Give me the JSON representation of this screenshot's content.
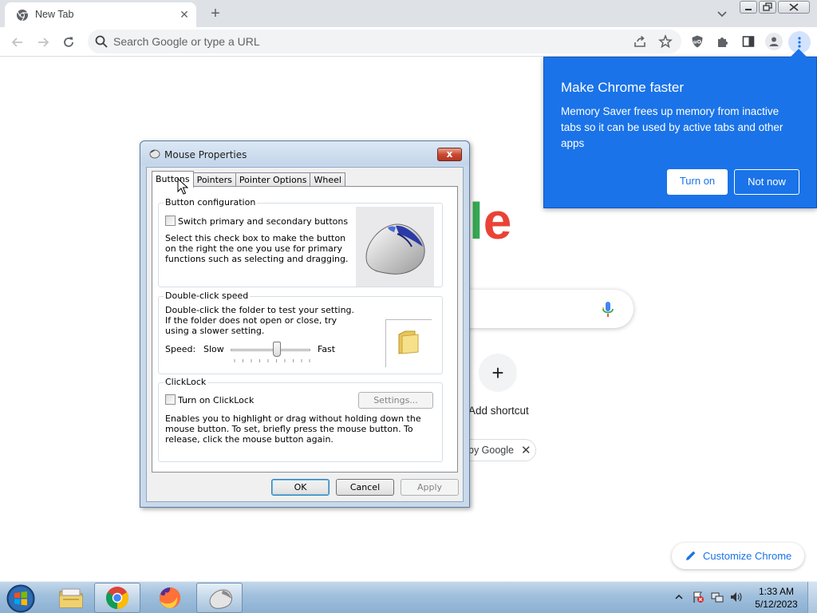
{
  "browser": {
    "tab_title": "New Tab",
    "omnibox_placeholder": "Search Google or type a URL"
  },
  "newtab_page": {
    "logo_fragment": [
      "l",
      "e"
    ],
    "shortcut_plus": "+",
    "shortcut_label": "Add shortcut",
    "chip_text": "by Google",
    "chip_close": "✕",
    "customize_label": "Customize Chrome"
  },
  "bubble": {
    "title": "Make Chrome faster",
    "body": "Memory Saver frees up memory from inactive tabs so it can be used by active tabs and other apps",
    "turn_on": "Turn on",
    "not_now": "Not now"
  },
  "dialog": {
    "title": "Mouse Properties",
    "close_glyph": "x",
    "tabs": [
      "Buttons",
      "Pointers",
      "Pointer Options",
      "Wheel"
    ],
    "button_config": {
      "label": "Button configuration",
      "checkbox": "Switch primary and secondary buttons",
      "desc": "Select this check box to make the button on the right the one you use for primary functions such as selecting and dragging."
    },
    "double_click": {
      "label": "Double-click speed",
      "desc": "Double-click the folder to test your setting. If the folder does not open or close, try using a slower setting.",
      "speed": "Speed:",
      "slow": "Slow",
      "fast": "Fast",
      "speed_level": 0.6
    },
    "clicklock": {
      "label": "ClickLock",
      "checkbox": "Turn on ClickLock",
      "settings": "Settings...",
      "desc": "Enables you to highlight or drag without holding down the mouse button. To set, briefly press the mouse button. To release, click the mouse button again."
    },
    "ok": "OK",
    "cancel": "Cancel",
    "apply": "Apply"
  },
  "taskbar": {
    "time": "1:33 AM",
    "date": "5/12/2023"
  },
  "colors": {
    "chrome_blue": "#1a73e8",
    "tabstrip": "#dee1e6"
  }
}
